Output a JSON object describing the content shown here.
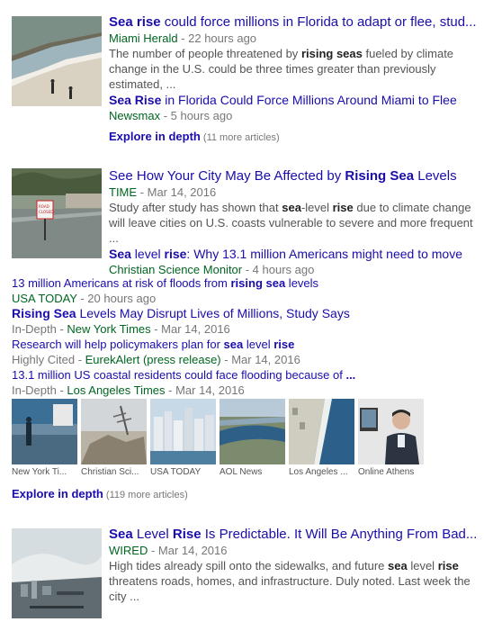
{
  "story1": {
    "title_bold": "Sea rise",
    "title_rest": " could force millions in Florida to adapt or flee, stud...",
    "source": "Miami Herald",
    "time": " - 22 hours ago",
    "snippet_a": "The number of people threatened by ",
    "snippet_b": "rising seas",
    "snippet_c": " fueled by climate change in the U.S. could be three times greater than previously estimated, ...",
    "related_title_bold": "Sea Rise",
    "related_title_rest": " in Florida Could Force Millions Around Miami to Flee",
    "related_source": "Newsmax",
    "related_time": " - 5 hours ago",
    "explore_label": "Explore in depth",
    "explore_count": " (11 more articles)"
  },
  "story2": {
    "title_a": "See How Your City May Be Affected by ",
    "title_bold": "Rising Sea",
    "title_b": " Levels",
    "source": "TIME",
    "time": " - Mar 14, 2016",
    "snippet_a": "Study after study has shown that ",
    "snippet_b": "sea",
    "snippet_c": "-level ",
    "snippet_d": "rise",
    "snippet_e": " due to climate change will leave cities on U.S. coasts vulnerable to severe and more frequent ...",
    "related_title_bold": "Sea",
    "related_title_mid": " level ",
    "related_title_bold2": "rise",
    "related_title_rest": ": Why 13.1 million Americans might need to move",
    "related_source": "Christian Science Monitor",
    "related_time": " - 4 hours ago",
    "more": [
      {
        "t1": "13 million Americans at risk of floods from ",
        "b": "rising sea",
        "t2": " levels",
        "prefix": "",
        "source": "USA TODAY",
        "time": " - 20 hours ago"
      },
      {
        "b0": "Rising Sea",
        "t1": " Levels May Disrupt Lives of Millions, Study Says",
        "prefix": "In-Depth - ",
        "source": "New York Times",
        "time": " - Mar 14, 2016"
      },
      {
        "t1": "Research will help policymakers plan for ",
        "b": "sea",
        "t2": " level ",
        "b2": "rise",
        "prefix": "Highly Cited - ",
        "source": "EurekAlert (press release)",
        "time": " - Mar 14, 2016"
      },
      {
        "t1": "13.1 million US coastal residents could face flooding because of ",
        "b": "...",
        "prefix": "In-Depth - ",
        "source": "Los Angeles Times",
        "time": " - Mar 14, 2016"
      }
    ],
    "gallery": [
      "New York Ti...",
      "Christian Sci...",
      "USA TODAY",
      "AOL News",
      "Los Angeles ...",
      "Online Athens"
    ],
    "explore_label": "Explore in depth",
    "explore_count": " (119 more articles)"
  },
  "story3": {
    "title_bold": "Sea",
    "title_mid": " Level ",
    "title_bold2": "Rise",
    "title_rest": " Is Predictable. It Will Be Anything From Bad...",
    "source": "WIRED",
    "time": " - Mar 14, 2016",
    "snippet_a": "High tides already spill onto the sidewalks, and future ",
    "snippet_b": "sea",
    "snippet_c": " level ",
    "snippet_d": "rise",
    "snippet_e": " threatens roads, homes, and infrastructure. Duly noted. Last week the city ..."
  }
}
